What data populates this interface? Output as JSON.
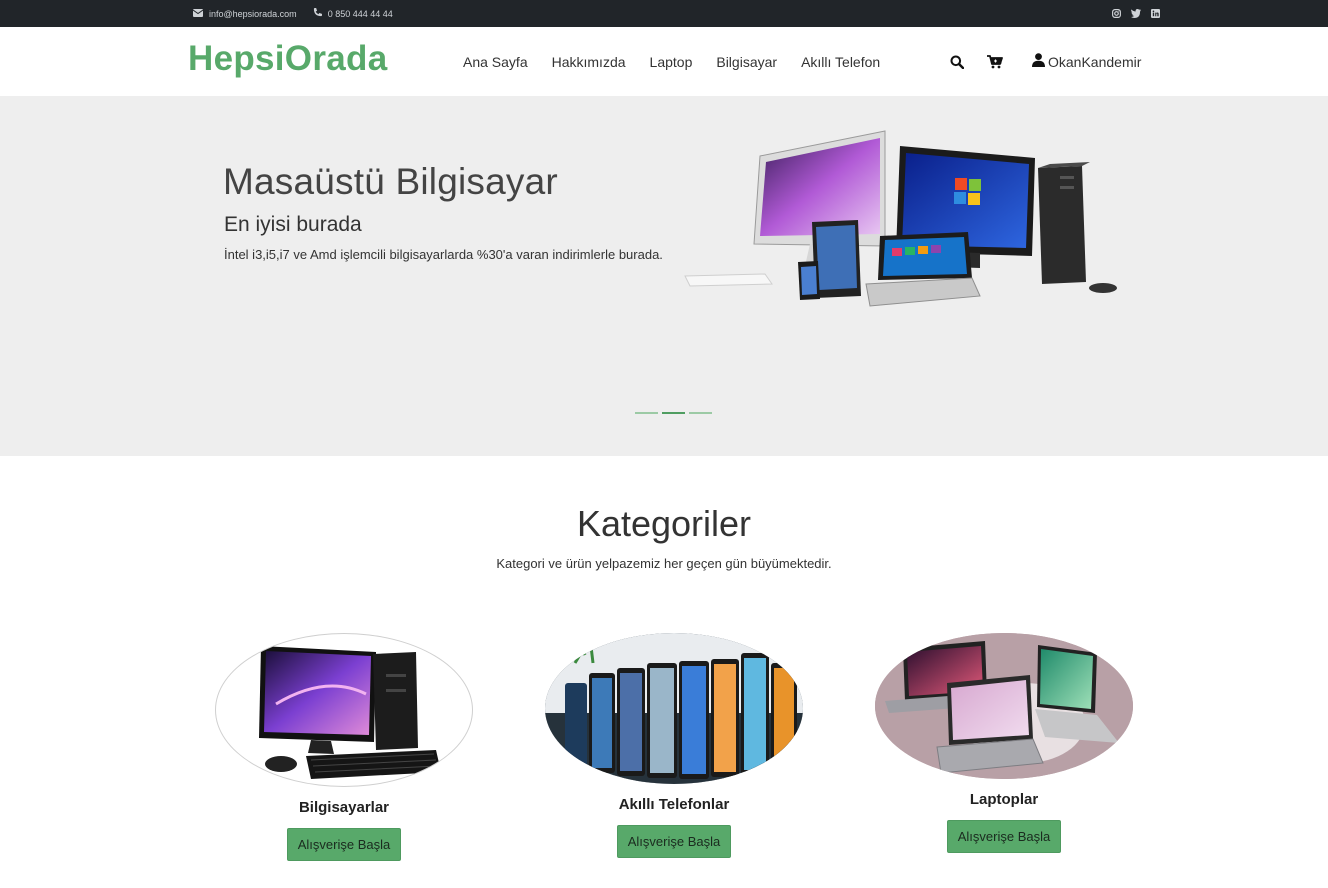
{
  "topbar": {
    "email": "info@hepsiorada.com",
    "phone": "0 850 444 44 44",
    "social_icons": [
      "instagram-icon",
      "twitter-icon",
      "linkedin-icon"
    ]
  },
  "navbar": {
    "brand": "HepsiOrada",
    "menu": [
      "Ana Sayfa",
      "Hakkımızda",
      "Laptop",
      "Bilgisayar",
      "Akıllı Telefon"
    ],
    "icons": [
      "search-icon",
      "cart-icon",
      "user-icon"
    ],
    "user": "OkanKandemir"
  },
  "hero": {
    "title": "Masaüstü Bilgisayar",
    "subtitle": "En iyisi burada",
    "description": "İntel i3,i5,i7 ve Amd işlemcili bilgisayarlarda %30'a varan indirimlerle burada.",
    "slides": 3,
    "active_slide": 2
  },
  "categories": {
    "title": "Kategoriler",
    "description": "Kategori ve ürün yelpazemiz her geçen gün büyümektedir.",
    "items": [
      {
        "name": "Bilgisayarlar",
        "button": "Alışverişe Başla"
      },
      {
        "name": "Akıllı Telefonlar",
        "button": "Alışverişe Başla"
      },
      {
        "name": "Laptoplar",
        "button": "Alışverişe Başla"
      }
    ]
  },
  "colors": {
    "brand": "#58a96a",
    "topbar": "#212529",
    "hero_bg": "#eeeeee"
  }
}
